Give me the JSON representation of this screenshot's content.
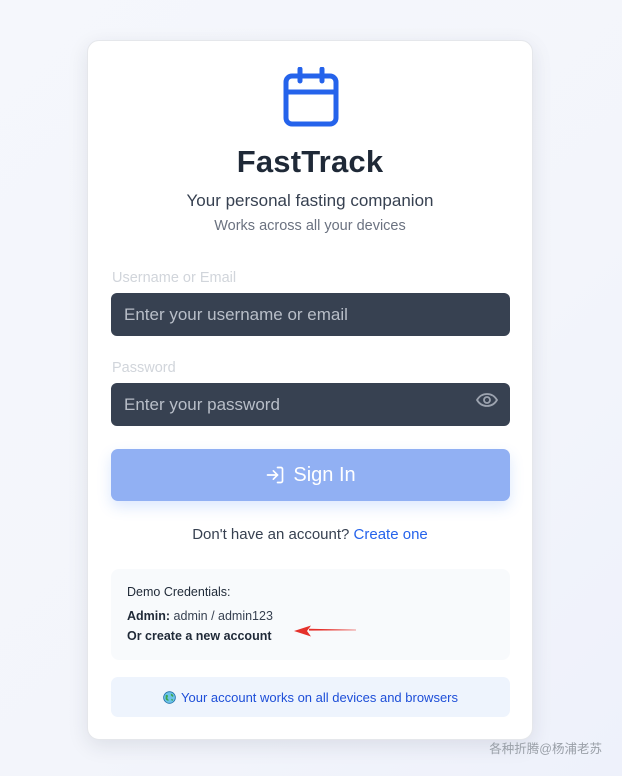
{
  "app": {
    "title": "FastTrack",
    "subtitle": "Your personal fasting companion",
    "tagline": "Works across all your devices",
    "icon": "calendar-icon",
    "accent": "#2563eb"
  },
  "form": {
    "username": {
      "label": "Username or Email",
      "placeholder": "Enter your username or email",
      "value": ""
    },
    "password": {
      "label": "Password",
      "placeholder": "Enter your password",
      "value": "",
      "toggle_icon": "eye-icon"
    },
    "submit": {
      "label": "Sign In",
      "icon": "login-icon",
      "color": "#91b0f3"
    }
  },
  "signup": {
    "prompt": "Don't have an account?",
    "link": "Create one"
  },
  "demo": {
    "heading": "Demo Credentials:",
    "admin_label": "Admin:",
    "admin_value": "admin / admin123",
    "create_note": "Or create a new account",
    "annotation_icon": "arrow-icon",
    "annotation_color": "#e5312b"
  },
  "info": {
    "icon": "globe-icon",
    "text": "Your account works on all devices and browsers"
  },
  "watermark": "各种折腾@杨浦老苏"
}
